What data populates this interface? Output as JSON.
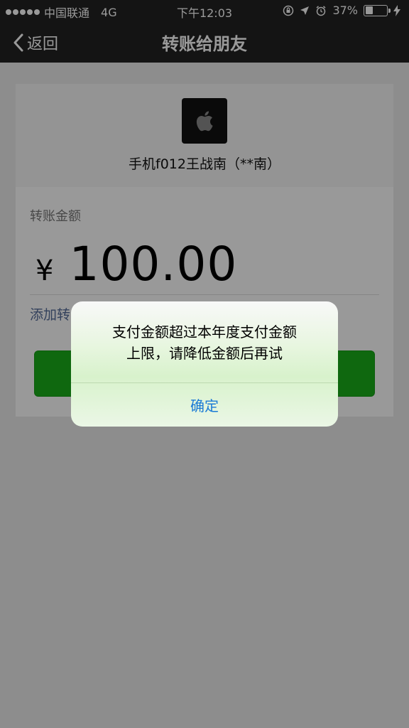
{
  "status_bar": {
    "carrier": "中国联通",
    "network": "4G",
    "time": "下午12:03",
    "battery_percent": "37%",
    "battery_level": 0.37
  },
  "nav": {
    "back_label": "返回",
    "title": "转账给朋友"
  },
  "recipient": {
    "avatar_icon": "apple-logo-icon",
    "name": "手机f012王战南（**南）"
  },
  "transfer": {
    "amount_label": "转账金额",
    "currency_symbol": "¥",
    "amount": "100.00",
    "add_note_label": "添加转"
  },
  "alert": {
    "message_line1": "支付金额超过本年度支付金额",
    "message_line2": "上限，请降低金额后再试",
    "button_label": "确定"
  },
  "colors": {
    "dark_bar": "#222222",
    "primary_green": "#1aad19",
    "alert_button_blue": "#1a7ad6",
    "link_blue": "#566d9a"
  }
}
